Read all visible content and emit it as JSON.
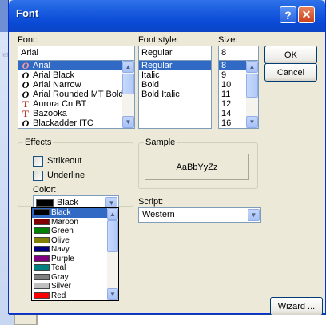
{
  "background": {
    "left_label": "lett"
  },
  "dialog": {
    "title": "Font",
    "title_buttons": {
      "help": "?",
      "close": "✕"
    },
    "font": {
      "label": "Font:",
      "value": "Arial",
      "items": [
        "Arial",
        "Arial Black",
        "Arial Narrow",
        "Arial Rounded MT Bold",
        "Aurora Cn BT",
        "Bazooka",
        "Blackadder ITC"
      ],
      "selected_index": 0,
      "glyphs": [
        "O",
        "O",
        "O",
        "O",
        "T",
        "T",
        "O"
      ]
    },
    "style": {
      "label": "Font style:",
      "value": "Regular",
      "items": [
        "Regular",
        "Italic",
        "Bold",
        "Bold Italic"
      ],
      "selected_index": 0
    },
    "size": {
      "label": "Size:",
      "value": "8",
      "items": [
        "8",
        "9",
        "10",
        "11",
        "12",
        "14",
        "16"
      ],
      "selected_index": 0
    },
    "buttons": {
      "ok": "OK",
      "cancel": "Cancel",
      "wizard": "Wizard ..."
    },
    "effects": {
      "label": "Effects",
      "strikeout": "Strikeout",
      "underline": "Underline",
      "color_label": "Color:",
      "color_value": "Black"
    },
    "sample": {
      "label": "Sample",
      "text": "AaBbYyZz"
    },
    "script": {
      "label": "Script:",
      "value": "Western"
    },
    "color_dropdown": {
      "items": [
        {
          "name": "Black",
          "color": "#000000"
        },
        {
          "name": "Maroon",
          "color": "#800000"
        },
        {
          "name": "Green",
          "color": "#008000"
        },
        {
          "name": "Olive",
          "color": "#808000"
        },
        {
          "name": "Navy",
          "color": "#000080"
        },
        {
          "name": "Purple",
          "color": "#800080"
        },
        {
          "name": "Teal",
          "color": "#008080"
        },
        {
          "name": "Gray",
          "color": "#808080"
        },
        {
          "name": "Silver",
          "color": "#c0c0c0"
        },
        {
          "name": "Red",
          "color": "#ff0000"
        }
      ],
      "selected_index": 0
    }
  },
  "colors": {
    "selection": "#316ac5",
    "titlebar": "#0a4ad6",
    "dialog_bg": "#ece9d8"
  }
}
